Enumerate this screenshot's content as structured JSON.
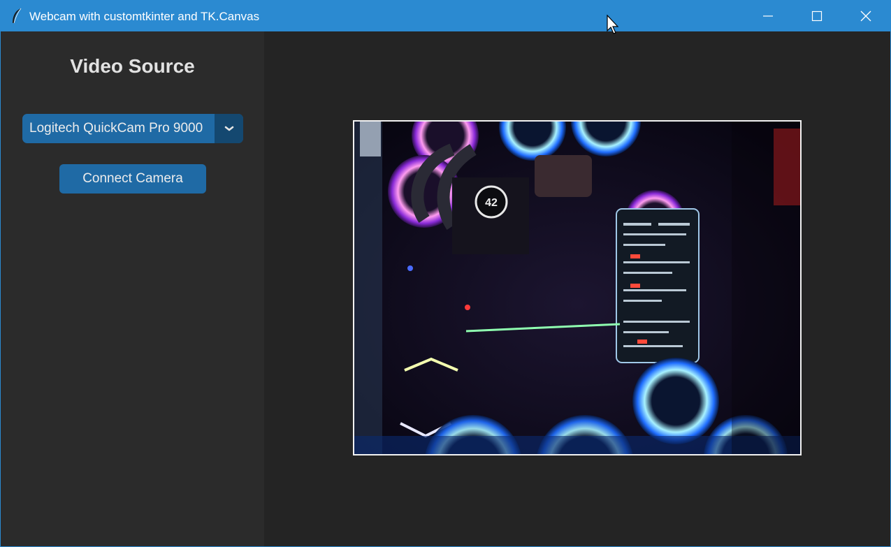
{
  "window": {
    "title": "Webcam with customtkinter and TK.Canvas",
    "accent_color": "#2b8ad1"
  },
  "titlebar_buttons": {
    "minimize_icon": "minimize-icon",
    "maximize_icon": "maximize-icon",
    "close_icon": "close-icon"
  },
  "sidebar": {
    "title": "Video Source",
    "camera_select": {
      "value": "Logitech QuickCam Pro 9000",
      "arrow_icon": "chevron-down-icon"
    },
    "connect_label": "Connect Camera",
    "button_color": "#1f6aa5"
  },
  "video": {
    "content": "webcam-feed"
  }
}
